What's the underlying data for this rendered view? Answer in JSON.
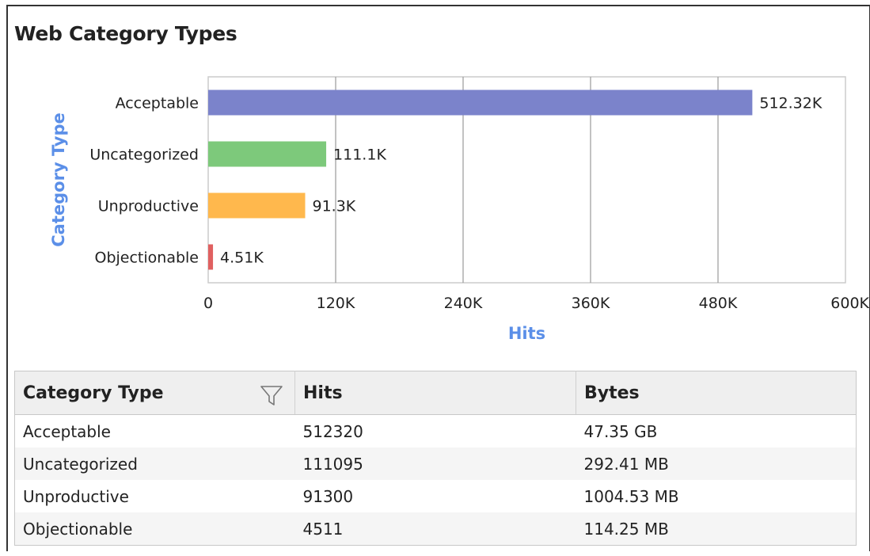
{
  "page": {
    "title": "Web Category Types"
  },
  "colors": {
    "axis_title": "#5b8fe8",
    "grid": "#999999",
    "plot_border": "#cccccc"
  },
  "chart_data": {
    "type": "bar",
    "orientation": "horizontal",
    "categories": [
      "Acceptable",
      "Uncategorized",
      "Unproductive",
      "Objectionable"
    ],
    "values": [
      512320,
      111095,
      91300,
      4511
    ],
    "value_labels": [
      "512.32K",
      "111.1K",
      "91.3K",
      "4.51K"
    ],
    "bar_colors": [
      "#7b83cb",
      "#7dc97b",
      "#ffb84d",
      "#e06060"
    ],
    "xlabel": "Hits",
    "ylabel": "Category Type",
    "xlim": [
      0,
      600000
    ],
    "x_ticks": [
      0,
      120000,
      240000,
      360000,
      480000,
      600000
    ],
    "x_tick_labels": [
      "0",
      "120K",
      "240K",
      "360K",
      "480K",
      "600K"
    ],
    "grid": true
  },
  "table": {
    "headers": [
      "Category Type",
      "Hits",
      "Bytes"
    ],
    "rows": [
      [
        "Acceptable",
        "512320",
        "47.35 GB"
      ],
      [
        "Uncategorized",
        "111095",
        "292.41 MB"
      ],
      [
        "Unproductive",
        "91300",
        "1004.53 MB"
      ],
      [
        "Objectionable",
        "4511",
        "114.25 MB"
      ]
    ]
  }
}
